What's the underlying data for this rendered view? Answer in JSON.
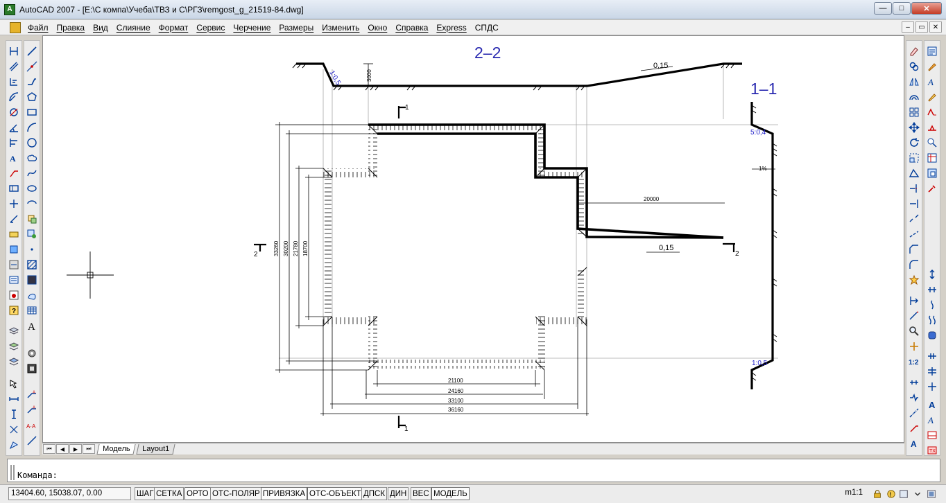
{
  "window": {
    "title": "AutoCAD 2007 - [E:\\С компа\\Учеба\\ТВЗ и С\\РГЗ\\remgost_g_21519-84.dwg]",
    "min": "—",
    "max": "□",
    "close": "✕",
    "app_icon_glyph": "A"
  },
  "menu": {
    "items": [
      "Файл",
      "Правка",
      "Вид",
      "Слияние",
      "Формат",
      "Сервис",
      "Черчение",
      "Размеры",
      "Изменить",
      "Окно",
      "Справка",
      "Express",
      "СПДС"
    ],
    "mdi": [
      "–",
      "▭",
      "✕"
    ]
  },
  "drawing": {
    "section_2": "2–2",
    "section_1": "1–1",
    "marks": {
      "cut1_top": "1",
      "cut1_bottom": "1",
      "cut2_left": "2",
      "cut2_right": "2"
    },
    "slopes": {
      "upper": "0,15",
      "lower": "0,15",
      "left_wall": "1:0,5",
      "right_top": "5:0,4",
      "right_bottom": "1:0,5"
    },
    "dims": {
      "depth": "3000",
      "h1": "21100",
      "h2": "24160",
      "h3": "33100",
      "h4": "36160",
      "v1": "33260",
      "v2": "30200",
      "v3": "21780",
      "v4": "18700",
      "channel": "20000",
      "section1": "1%"
    }
  },
  "tabs": {
    "nav": [
      "⏮",
      "◀",
      "▶",
      "⏭"
    ],
    "model": "Модель",
    "layout": "Layout1"
  },
  "command": {
    "prompt": "Команда:"
  },
  "status": {
    "coords": "13404.60, 15038.07, 0.00",
    "buttons": [
      {
        "label": "ШАГ",
        "on": false
      },
      {
        "label": "СЕТКА",
        "on": false
      },
      {
        "label": "ОРТО",
        "on": true
      },
      {
        "label": "ОТС-ПОЛЯР",
        "on": false
      },
      {
        "label": "ПРИВЯЗКА",
        "on": true
      },
      {
        "label": "ОТС-ОБЪЕКТ",
        "on": true
      },
      {
        "label": "ДПСК",
        "on": false
      },
      {
        "label": "ДИН",
        "on": false
      },
      {
        "label": "ВЕС",
        "on": false
      },
      {
        "label": "МОДЕЛЬ",
        "on": true
      }
    ],
    "scale": "m1:1"
  },
  "colors": {
    "accent": "#1c1cc8",
    "section_blue": "#2a2ab0",
    "titlebar": "#c9d6e6"
  }
}
